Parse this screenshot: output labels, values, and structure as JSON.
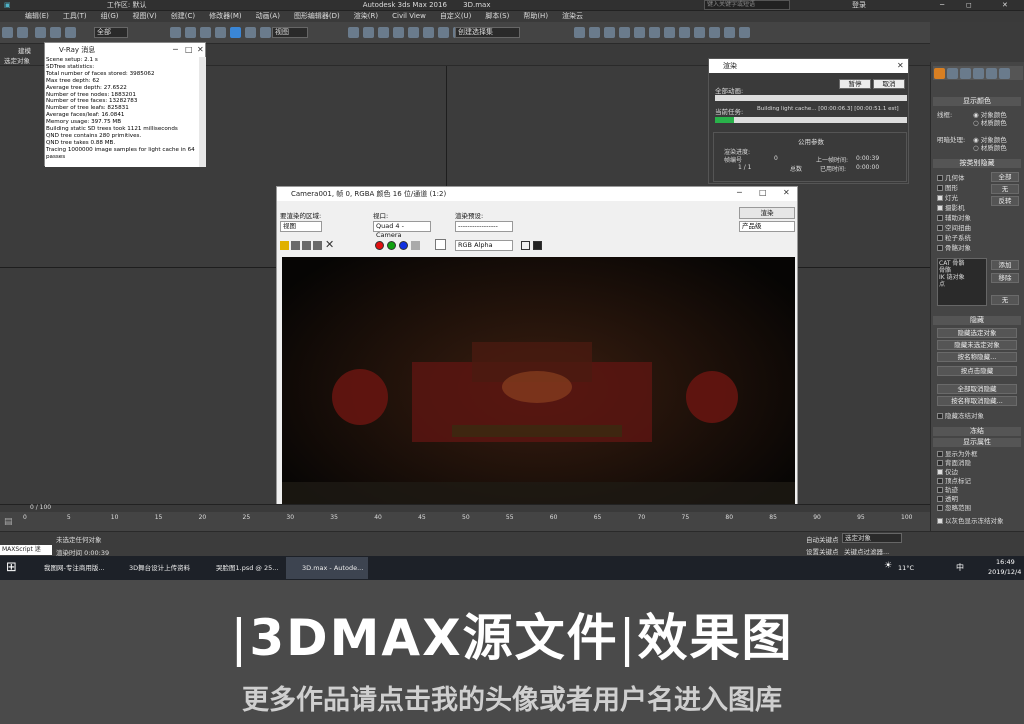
{
  "titlebar": {
    "workspace": "工作区: 默认",
    "app_title": "Autodesk 3ds Max 2016",
    "file": "3D.max",
    "search_placeholder": "键入关键字或短语",
    "login": "登录"
  },
  "menu": [
    "编辑(E)",
    "工具(T)",
    "组(G)",
    "视图(V)",
    "创建(C)",
    "修改器(M)",
    "动画(A)",
    "图形编辑器(D)",
    "渲染(R)",
    "Civil View",
    "自定义(U)",
    "脚本(S)",
    "帮助(H)",
    "渲染云"
  ],
  "toolbar": {
    "filter": "全部",
    "view": "视图",
    "selection_set": "创建选择集"
  },
  "leftstrip": {
    "a": "建模",
    "b": "选定对象"
  },
  "vray_log": {
    "title": "V-Ray 消息",
    "lines": [
      "Scene setup: 2.1 s",
      "SDTree statistics:",
      "Total number of faces stored: 3985062",
      "Max tree depth: 62",
      "Average tree depth: 27.6522",
      "Number of tree nodes: 1883201",
      "Number of tree faces: 13282783",
      "Number of tree leafs: 825831",
      "Average faces/leaf: 16.0841",
      "Memory usage: 397.75 MB",
      "Building static SD trees took 1121 milliseconds",
      "QND tree contains 280 primitives.",
      "QND tree takes 0.88 MB.",
      "Tracing 1000000 image samples for light cache in 64 passes"
    ]
  },
  "render_dialog": {
    "title": "渲染",
    "pause": "暂停",
    "cancel": "取消",
    "overall": "全部动画:",
    "current_task_label": "当前任务:",
    "current_task": "Building light cache... [00:00:06.3] [00:00:51.1 est]",
    "common_params": "公用参数",
    "render_progress": "渲染进度:",
    "frame_num": "帧编号",
    "frame_val": "0",
    "frame_count": "1 / 1",
    "total": "总数",
    "last_frame_time_label": "上一帧时间:",
    "last_frame_time": "0:00:39",
    "elapsed_label": "已用时间:",
    "elapsed": "0:00:00"
  },
  "frame_window": {
    "title": "Camera001, 帧 0, RGBA 颜色 16 位/通道 (1:2)",
    "area_label": "要渲染的区域:",
    "area_value": "视图",
    "viewport_label": "视口:",
    "viewport_value": "Quad 4 - Camera",
    "preset_label": "渲染预设:",
    "preset_value": "-----------------",
    "render_btn": "渲染",
    "product_value": "产品级",
    "channel": "RGB Alpha"
  },
  "command_panel": {
    "display_color": "显示颜色",
    "wireframe": "线框:",
    "object_color": "对象颜色",
    "material_color": "材质颜色",
    "shaded": "明暗处理:",
    "hide_by_category": "按类别隐藏",
    "categories": [
      {
        "label": "几何体",
        "checked": false
      },
      {
        "label": "图形",
        "checked": false
      },
      {
        "label": "灯光",
        "checked": true
      },
      {
        "label": "摄影机",
        "checked": true
      },
      {
        "label": "辅助对象",
        "checked": false
      },
      {
        "label": "空间扭曲",
        "checked": false
      },
      {
        "label": "粒子系统",
        "checked": false
      },
      {
        "label": "骨骼对象",
        "checked": false
      }
    ],
    "all": "全部",
    "none": "无",
    "invert": "反转",
    "list_items": [
      "CAT 骨骼",
      "骨骼",
      "IK 链对象",
      "点"
    ],
    "add": "添加",
    "remove": "移除",
    "none2": "无",
    "hide": "隐藏",
    "hide_buttons": [
      "隐藏选定对象",
      "隐藏未选定对象",
      "按名称隐藏...",
      "按点击隐藏"
    ],
    "unhide_buttons": [
      "全部取消隐藏",
      "按名称取消隐藏..."
    ],
    "hide_frozen": "隐藏冻结对象",
    "freeze": "冻结",
    "display_props": "显示属性",
    "props": [
      {
        "label": "显示为外框",
        "checked": false
      },
      {
        "label": "背面消隐",
        "checked": false
      },
      {
        "label": "仅边",
        "checked": true
      },
      {
        "label": "顶点标记",
        "checked": false
      },
      {
        "label": "轨迹",
        "checked": false
      },
      {
        "label": "透明",
        "checked": false
      },
      {
        "label": "忽略范围",
        "checked": false
      },
      {
        "label": "以灰色显示冻结对象",
        "checked": true
      }
    ]
  },
  "timeline": {
    "position": "0 / 100",
    "ticks": [
      "0",
      "5",
      "10",
      "15",
      "20",
      "25",
      "30",
      "35",
      "40",
      "45",
      "50",
      "55",
      "60",
      "65",
      "70",
      "75",
      "80",
      "85",
      "90",
      "95",
      "100"
    ]
  },
  "statusbar": {
    "maxscript": "MAXScript 迷",
    "none_selected": "未选定任何对象",
    "render_time": "渲染时间 0:00:39",
    "auto_key": "自动关键点",
    "selected": "选定对象",
    "set_key": "设置关键点",
    "key_filter": "关键点过滤器..."
  },
  "taskbar": {
    "items": [
      "我图网-专注商用版...",
      "3D舞台设计上传资料",
      "哭脸图1.psd @ 25...",
      "3D.max - Autode..."
    ],
    "temp": "11°C",
    "ime": "中",
    "time": "16:49",
    "date": "2019/12/4"
  },
  "banner": {
    "title": "3DMAX源文件",
    "title2": "效果图",
    "subtitle": "更多作品请点击我的头像或者用户名进入图库"
  }
}
